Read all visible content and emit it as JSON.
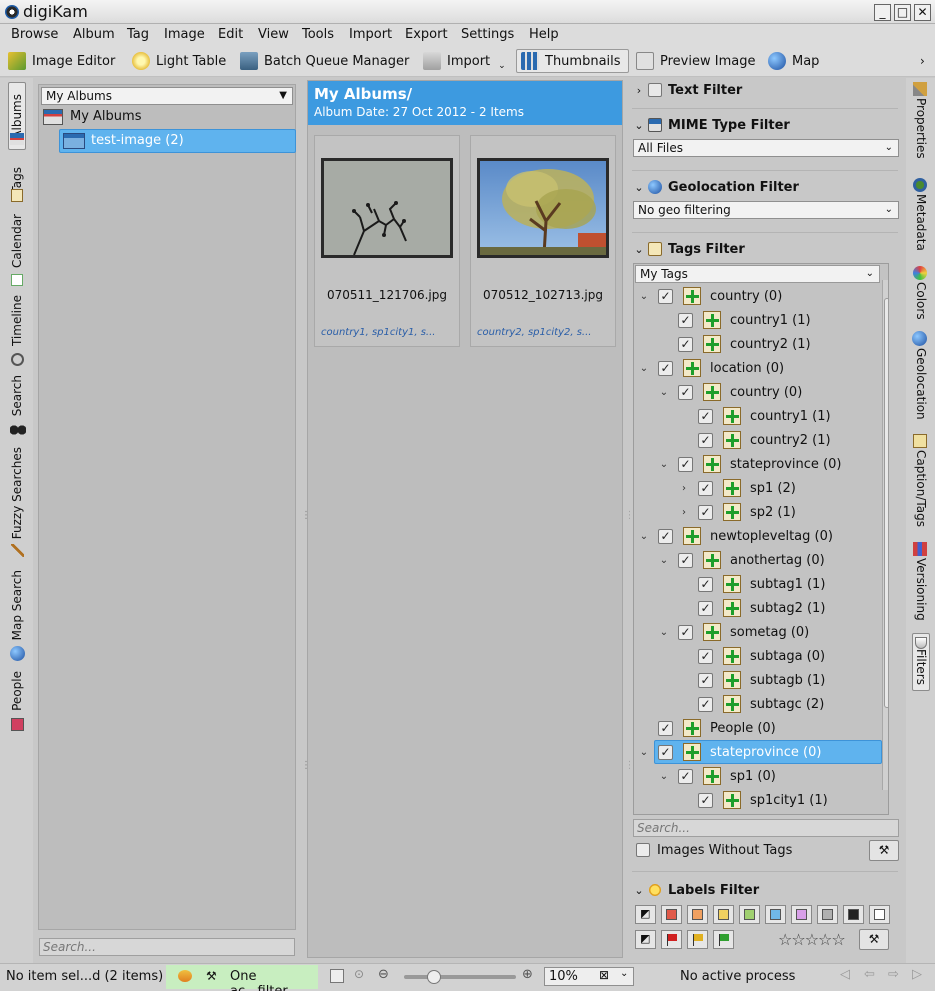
{
  "window": {
    "title": "digiKam",
    "buttons": [
      "_",
      "□",
      "✕"
    ]
  },
  "menu": [
    "Browse",
    "Album",
    "Tag",
    "Image",
    "Edit",
    "View",
    "Tools",
    "Import",
    "Export",
    "Settings",
    "Help"
  ],
  "toolbar": {
    "image_editor": "Image Editor",
    "light_table": "Light Table",
    "batch_queue": "Batch Queue Manager",
    "import": "Import",
    "thumbnails": "Thumbnails",
    "preview": "Preview Image",
    "map": "Map"
  },
  "left_tabs": [
    "Albums",
    "Tags",
    "Calendar",
    "Timeline",
    "Search",
    "Fuzzy Searches",
    "Map Search",
    "People"
  ],
  "album_panel": {
    "combo": "My Albums",
    "root": "My Albums",
    "child": "test-image (2)",
    "search_placeholder": "Search..."
  },
  "center": {
    "title": "My Albums/",
    "subtitle": "Album Date: 27 Oct 2012 - 2 Items",
    "items": [
      {
        "name": "070511_121706.jpg",
        "tags": "country1, sp1city1, s..."
      },
      {
        "name": "070512_102713.jpg",
        "tags": "country2, sp1city2, s..."
      }
    ]
  },
  "filters": {
    "text_filter": "Text Filter",
    "mime_filter": "MIME Type Filter",
    "mime_value": "All Files",
    "geo_filter": "Geolocation Filter",
    "geo_value": "No geo filtering",
    "tags_filter": "Tags Filter",
    "tags_combo": "My Tags",
    "tree": [
      {
        "label": "country (0)",
        "depth": 0,
        "exp": "v",
        "sel": false
      },
      {
        "label": "country1 (1)",
        "depth": 1,
        "exp": "",
        "sel": false
      },
      {
        "label": "country2 (1)",
        "depth": 1,
        "exp": "",
        "sel": false
      },
      {
        "label": "location (0)",
        "depth": 0,
        "exp": "v",
        "sel": false
      },
      {
        "label": "country (0)",
        "depth": 1,
        "exp": "v",
        "sel": false
      },
      {
        "label": "country1 (1)",
        "depth": 2,
        "exp": "",
        "sel": false
      },
      {
        "label": "country2 (1)",
        "depth": 2,
        "exp": "",
        "sel": false
      },
      {
        "label": "stateprovince (0)",
        "depth": 1,
        "exp": "v",
        "sel": false
      },
      {
        "label": "sp1 (2)",
        "depth": 2,
        "exp": ">",
        "sel": false
      },
      {
        "label": "sp2 (1)",
        "depth": 2,
        "exp": ">",
        "sel": false
      },
      {
        "label": "newtopleveltag (0)",
        "depth": 0,
        "exp": "v",
        "sel": false
      },
      {
        "label": "anothertag (0)",
        "depth": 1,
        "exp": "v",
        "sel": false
      },
      {
        "label": "subtag1 (1)",
        "depth": 2,
        "exp": "",
        "sel": false
      },
      {
        "label": "subtag2 (1)",
        "depth": 2,
        "exp": "",
        "sel": false
      },
      {
        "label": "sometag (0)",
        "depth": 1,
        "exp": "v",
        "sel": false
      },
      {
        "label": "subtaga (0)",
        "depth": 2,
        "exp": "",
        "sel": false
      },
      {
        "label": "subtagb (1)",
        "depth": 2,
        "exp": "",
        "sel": false
      },
      {
        "label": "subtagc (2)",
        "depth": 2,
        "exp": "",
        "sel": false
      },
      {
        "label": "People (0)",
        "depth": 0,
        "exp": "",
        "sel": false
      },
      {
        "label": "stateprovince (0)",
        "depth": 0,
        "exp": "v",
        "sel": true
      },
      {
        "label": "sp1 (0)",
        "depth": 1,
        "exp": "v",
        "sel": false
      },
      {
        "label": "sp1city1 (1)",
        "depth": 2,
        "exp": "",
        "sel": false
      }
    ],
    "search_placeholder": "Search...",
    "without_tags": "Images Without Tags",
    "labels_filter": "Labels Filter",
    "color_swatches": [
      "#e05a4a",
      "#f0a060",
      "#f0d060",
      "#a0d070",
      "#70b8e8",
      "#d8a0e8",
      "#b0b0b0",
      "#222222",
      "#ffffff"
    ],
    "flag_colors": [
      "#d02020",
      "#e0b020",
      "#30a030"
    ]
  },
  "right_tabs": [
    "Properties",
    "Metadata",
    "Colors",
    "Geolocation",
    "Caption/Tags",
    "Versioning",
    "Filters"
  ],
  "status": {
    "selection": "No item sel...d (2 items)",
    "filter": "One ac...filter",
    "zoom": "10%",
    "process": "No active process"
  }
}
